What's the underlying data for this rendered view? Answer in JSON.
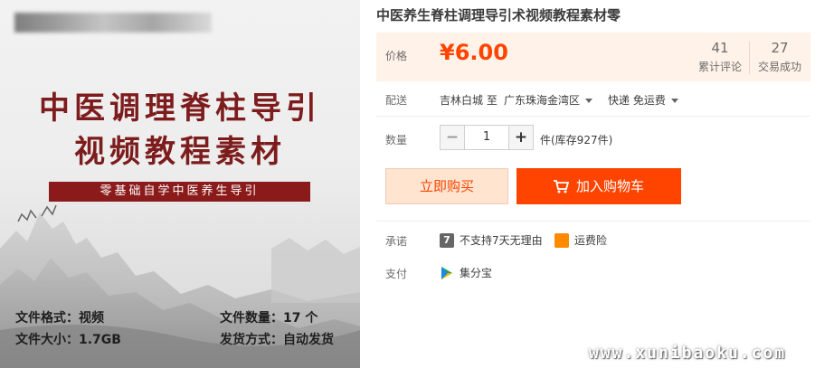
{
  "image": {
    "title_line1": "中医调理脊柱导引",
    "title_line2": "视频教程素材",
    "banner": "零基础自学中医养生导引",
    "format": "文件格式：视频",
    "size": "文件大小：1.7GB",
    "count": "文件数量：17 个",
    "delivery": "发货方式：自动发货"
  },
  "product": {
    "title": "中医养生脊柱调理导引术视频教程素材零"
  },
  "price": {
    "label": "价格",
    "value": "¥6.00",
    "reviews_count": "41",
    "reviews_label": "累计评论",
    "trades_count": "27",
    "trades_label": "交易成功"
  },
  "shipping": {
    "label": "配送",
    "origin": "吉林白城 至",
    "destination": "广东珠海金湾区",
    "method": "快递 免运费"
  },
  "quantity": {
    "label": "数量",
    "minus": "−",
    "value": "1",
    "plus": "+",
    "stock": "件(库存927件)"
  },
  "actions": {
    "buy_now": "立即购买",
    "add_to_cart": "加入购物车"
  },
  "promise": {
    "label": "承诺",
    "no_return": "不支持7天无理由",
    "shipping_insurance": "运费险"
  },
  "payment": {
    "label": "支付",
    "method": "集分宝"
  },
  "watermark": "www.xunibaoku.com",
  "colors": {
    "accent": "#ff4400",
    "price_bg": "#fff2e8",
    "title_red": "#7d1c1c"
  }
}
